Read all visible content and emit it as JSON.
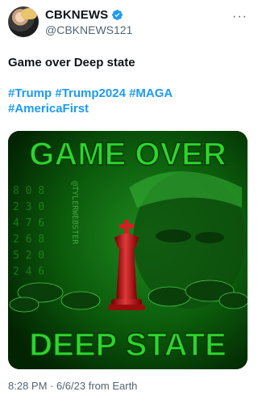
{
  "account": {
    "display_name": "CBKNEWS",
    "handle": "@CBKNEWS121",
    "verified_color": "#1d9bf0"
  },
  "tweet": {
    "text": "Game over Deep state",
    "hashtags": [
      "#Trump",
      "#Trump2024",
      "#MAGA",
      "#AmericaFirst"
    ],
    "timestamp": "8:28 PM · 6/6/23 from Earth"
  },
  "media": {
    "headline_top": "GAME OVER",
    "headline_bottom": "DEEP STATE",
    "watermark": "@TYLERWEBSTER",
    "accent_color": "#2bd62b"
  },
  "icons": {
    "more": "more-options-icon",
    "verified": "verified-badge-icon"
  }
}
